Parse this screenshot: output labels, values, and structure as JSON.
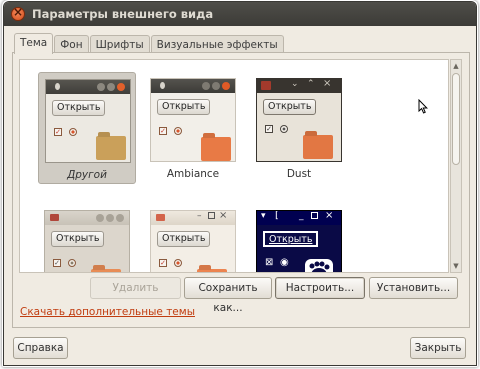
{
  "window": {
    "title": "Параметры внешнего вида"
  },
  "tabs": [
    {
      "label": "Тема",
      "active": true
    },
    {
      "label": "Фон",
      "active": false
    },
    {
      "label": "Шрифты",
      "active": false
    },
    {
      "label": "Визуальные эффекты",
      "active": false
    }
  ],
  "themes": [
    {
      "name": "Другой",
      "selected": true,
      "open_label": "Открыть"
    },
    {
      "name": "Ambiance",
      "selected": false,
      "open_label": "Открыть"
    },
    {
      "name": "Dust",
      "selected": false,
      "open_label": "Открыть"
    },
    {
      "name": "",
      "selected": false,
      "open_label": "Открыть"
    },
    {
      "name": "",
      "selected": false,
      "open_label": "Открыть"
    },
    {
      "name": "",
      "selected": false,
      "open_label": "Открыть"
    }
  ],
  "actions": {
    "delete": "Удалить",
    "save_as": "Сохранить как...",
    "customize": "Настроить...",
    "install": "Установить..."
  },
  "download_link": "Скачать дополнительные темы",
  "footer": {
    "help": "Справка",
    "close": "Закрыть"
  },
  "colors": {
    "accent": "#dd4814",
    "titlebar": "#3c3b37",
    "window_bg": "#f0ebe2"
  },
  "icons": [
    "close-icon",
    "scroll-up-icon",
    "scroll-down-icon",
    "mouse-cursor-icon",
    "folder-icon",
    "gnome-foot-icon"
  ]
}
